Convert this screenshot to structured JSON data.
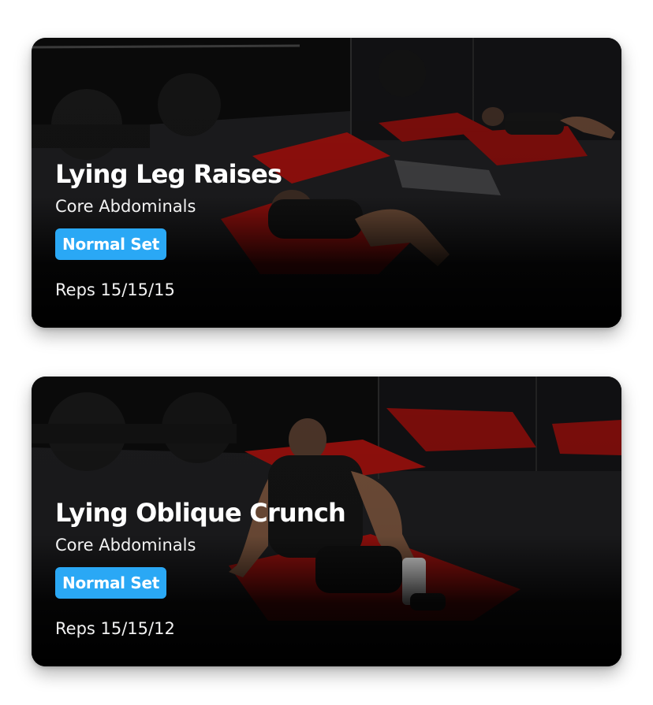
{
  "exercises": [
    {
      "name": "Lying Leg Raises",
      "category": "Core Abdominals",
      "set_type": "Normal Set",
      "reps": "Reps 15/15/15",
      "image": "man-lying-on-red-gym-mat"
    },
    {
      "name": "Lying Oblique Crunch",
      "category": "Core Abdominals",
      "set_type": "Normal Set",
      "reps": "Reps 15/15/12",
      "image": "man-sitting-on-red-gym-mat"
    }
  ],
  "colors": {
    "badge": "#2aa8f5",
    "mat": "#b3120f",
    "card_background": "#050505"
  }
}
